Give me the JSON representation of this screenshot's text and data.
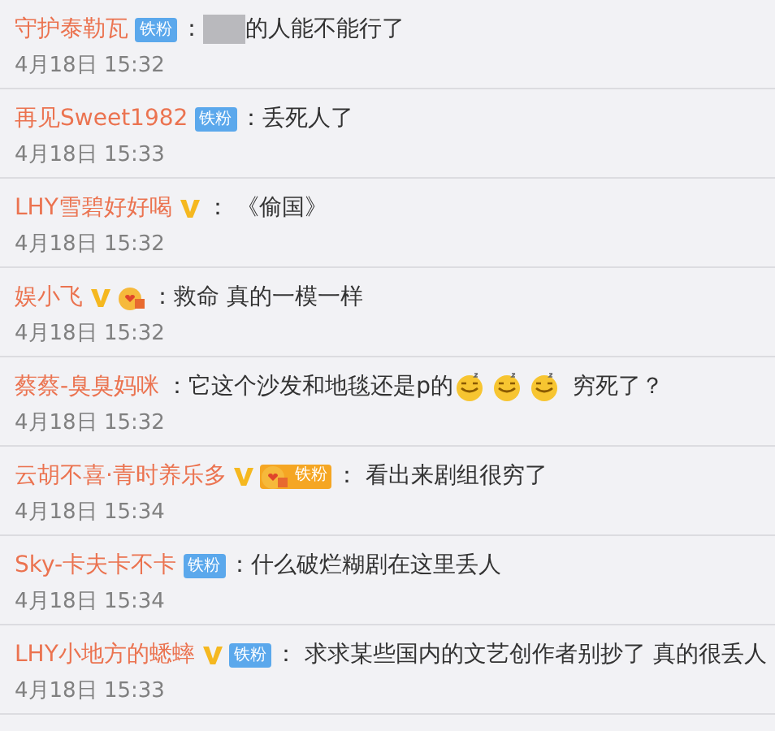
{
  "comments": [
    {
      "user": "守护泰勒瓦",
      "badges": [
        {
          "kind": "fan",
          "label": "铁粉"
        }
      ],
      "parts": [
        {
          "kind": "text",
          "text": "："
        },
        {
          "kind": "redacted"
        },
        {
          "kind": "text",
          "text": "的人能不能行了"
        }
      ],
      "time": "4月18日 15:32"
    },
    {
      "user": "再见Sweet1982",
      "badges": [
        {
          "kind": "fan",
          "label": "铁粉"
        }
      ],
      "parts": [
        {
          "kind": "text",
          "text": "：丢死人了"
        }
      ],
      "time": "4月18日 15:33"
    },
    {
      "user": "LHY雪碧好好喝",
      "badges": [
        {
          "kind": "verified"
        }
      ],
      "parts": [
        {
          "kind": "text",
          "text": "： 《偷国》"
        }
      ],
      "time": "4月18日 15:32"
    },
    {
      "user": "娱小飞",
      "badges": [
        {
          "kind": "verified"
        },
        {
          "kind": "gold-fan-icon"
        }
      ],
      "parts": [
        {
          "kind": "text",
          "text": "：救命 真的一模一样"
        }
      ],
      "time": "4月18日 15:32"
    },
    {
      "user": "蔡蔡-臭臭妈咪",
      "parts": [
        {
          "kind": "text",
          "text": "：它这个沙发和地毯还是p的"
        },
        {
          "kind": "emoji"
        },
        {
          "kind": "emoji"
        },
        {
          "kind": "emoji"
        },
        {
          "kind": "text",
          "text": " 穷死了？"
        }
      ],
      "time": "4月18日 15:32"
    },
    {
      "user": "云胡不喜·青时养乐多",
      "badges": [
        {
          "kind": "verified"
        },
        {
          "kind": "gold-fan",
          "label": "铁粉"
        }
      ],
      "parts": [
        {
          "kind": "text",
          "text": "： 看出来剧组很穷了"
        }
      ],
      "time": "4月18日 15:34"
    },
    {
      "user": "Sky-卡夫卡不卡",
      "badges": [
        {
          "kind": "fan",
          "label": "铁粉"
        }
      ],
      "parts": [
        {
          "kind": "text",
          "text": "：什么破烂糊剧在这里丢人"
        }
      ],
      "time": "4月18日 15:34"
    },
    {
      "user": "LHY小地方的蟋蟀",
      "badges": [
        {
          "kind": "verified"
        },
        {
          "kind": "fan",
          "label": "铁粉"
        }
      ],
      "parts": [
        {
          "kind": "text",
          "text": "： 求求某些国内的文艺创作者别抄了 真的很丢人"
        }
      ],
      "time": "4月18日 15:33"
    }
  ]
}
